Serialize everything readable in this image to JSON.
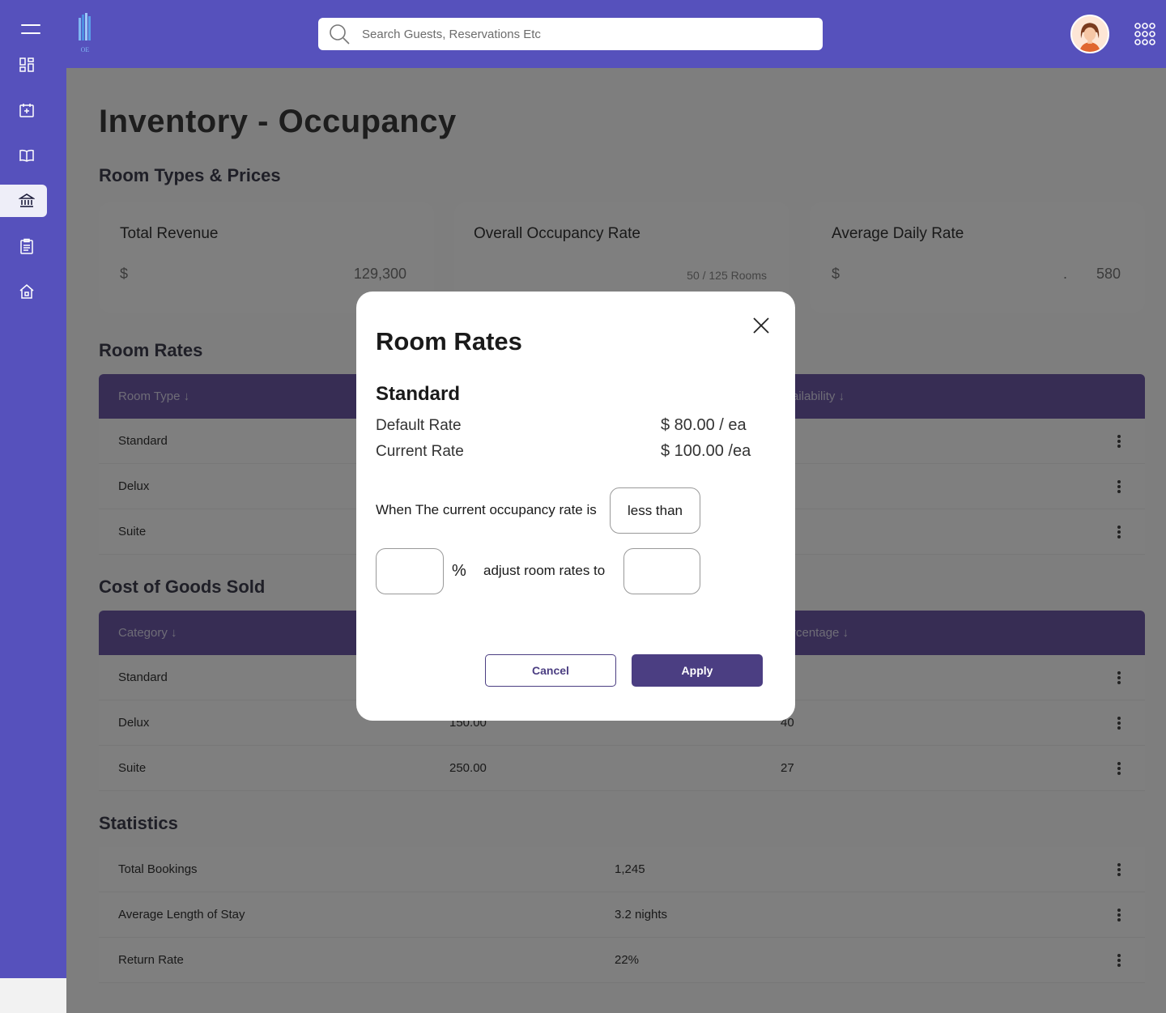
{
  "topbar": {
    "search_placeholder": "Search Guests, Reservations Etc",
    "logo_text": "OE"
  },
  "sidebar": {
    "items": [
      {
        "icon": "dashboard-icon"
      },
      {
        "icon": "calendar-icon"
      },
      {
        "icon": "book-icon"
      },
      {
        "icon": "bank-icon",
        "active": true
      },
      {
        "icon": "clipboard-icon"
      },
      {
        "icon": "house-icon"
      }
    ]
  },
  "page": {
    "title": "Inventory - Occupancy",
    "room_types_heading": "Room Types & Prices",
    "room_rates_heading": "Room Rates",
    "cogs_heading": "Cost of Goods Sold",
    "statistics_heading": "Statistics"
  },
  "cards": {
    "revenue": {
      "title": "Total Revenue",
      "currency": "$",
      "value": "129,300"
    },
    "occupancy": {
      "title": "Overall Occupancy Rate",
      "sub": "50 / 125 Rooms"
    },
    "adr": {
      "title": "Average Daily Rate",
      "currency": "$",
      "dot": ".",
      "value": "580"
    }
  },
  "room_rates_table": {
    "headers": [
      "Room Type ↓",
      "ailability ↓"
    ],
    "rows": [
      {
        "type": "Standard",
        "availability": ""
      },
      {
        "type": "Delux",
        "availability": ")"
      },
      {
        "type": "Suite",
        "availability": ""
      }
    ]
  },
  "cogs_table": {
    "headers": [
      "Category ↓",
      "rcentage ↓"
    ],
    "rows": [
      {
        "category": "Standard",
        "cost": "",
        "percentage": ""
      },
      {
        "category": "Delux",
        "cost": "150.00",
        "percentage": "40"
      },
      {
        "category": "Suite",
        "cost": "250.00",
        "percentage": "27"
      }
    ]
  },
  "statistics_table": {
    "rows": [
      {
        "label": "Total Bookings",
        "value": "1,245"
      },
      {
        "label": "Average Length of Stay",
        "value": "3.2 nights"
      },
      {
        "label": "Return Rate",
        "value": "22%"
      }
    ]
  },
  "modal": {
    "title": "Room Rates",
    "room_name": "Standard",
    "default_rate_label": "Default Rate",
    "default_rate_value": "$ 80.00 / ea",
    "current_rate_label": "Current Rate",
    "current_rate_value": "$ 100.00 /ea",
    "condition_text": "When The current occupancy rate is",
    "comparator": "less than",
    "percent_sign": "%",
    "adjust_text": "adjust room rates to",
    "percent_value": "",
    "rate_value": "",
    "cancel_label": "Cancel",
    "apply_label": "Apply"
  },
  "colors": {
    "brand": "#5651bc",
    "table_header": "#6e5ba8",
    "primary_button": "#4b3e82"
  }
}
